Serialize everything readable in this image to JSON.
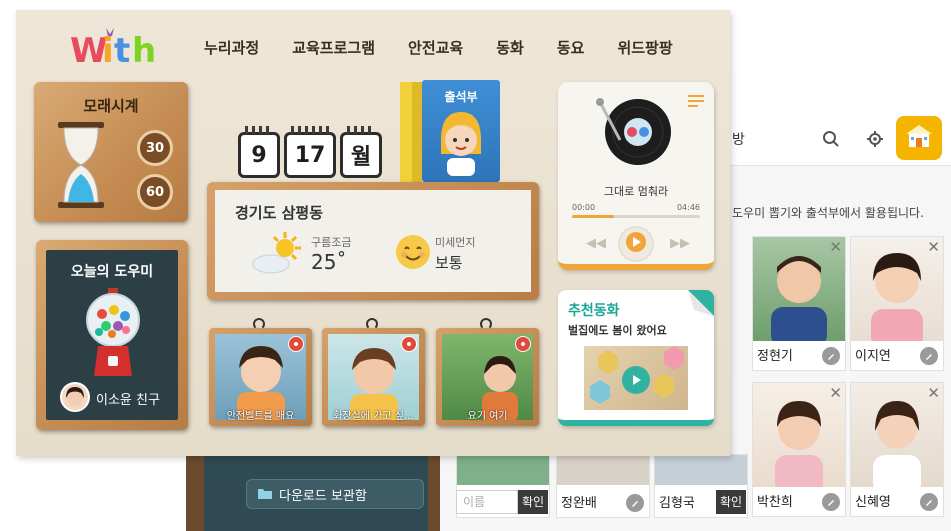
{
  "back_panel": {
    "title": "방",
    "description": "도우미 뽑기와 출석부에서 활용됩니다.",
    "children": [
      {
        "name": "정현기",
        "close": "✕"
      },
      {
        "name": "이지연",
        "close": "✕"
      },
      {
        "name": "박찬희",
        "close": "✕"
      },
      {
        "name": "신혜영",
        "close": "✕"
      },
      {
        "name": "정완배",
        "close": ""
      },
      {
        "name": "김형국",
        "close": ""
      }
    ],
    "name_input": {
      "placeholder": "이름",
      "confirm": "확인"
    },
    "download_label": "다운로드 보관함"
  },
  "nav": {
    "items": [
      "누리과정",
      "교육프로그램",
      "안전교육",
      "동화",
      "동요",
      "위드팡팡"
    ]
  },
  "hourglass": {
    "title": "모래시계",
    "timer_30": "30",
    "timer_60": "60"
  },
  "helper": {
    "title": "오늘의 도우미",
    "name": "이소윤 친구"
  },
  "date": {
    "day": "9",
    "date": "17",
    "unit": "월"
  },
  "book": {
    "title": "출석부"
  },
  "weather": {
    "location": "경기도 삼평동",
    "description": "구름조금",
    "temperature": "25˚",
    "dust_label": "미세먼지",
    "dust_value": "보통"
  },
  "music": {
    "song": "그대로 멈춰라",
    "time_start": "00:00",
    "time_end": "04:46",
    "progress": 0.33
  },
  "story": {
    "title": "추천동화",
    "subtitle": "벌집에도 봄이 왔어요"
  },
  "frames": [
    {
      "caption": "안전벨트를 매요"
    },
    {
      "caption": "화장실에 가고 싶…"
    },
    {
      "caption": "요기 여기"
    }
  ],
  "colors": {
    "accent_orange": "#f0a53a",
    "accent_teal": "#2fb3a0",
    "home_yellow": "#f5b400"
  }
}
